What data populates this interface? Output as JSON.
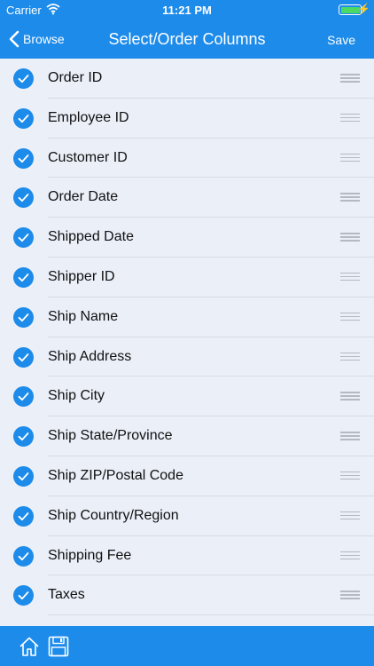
{
  "status_bar": {
    "carrier": "Carrier",
    "time": "11:21 PM"
  },
  "nav": {
    "back_label": "Browse",
    "title": "Select/Order Columns",
    "save_label": "Save"
  },
  "columns": [
    {
      "label": "Order ID",
      "checked": true
    },
    {
      "label": "Employee ID",
      "checked": true
    },
    {
      "label": "Customer ID",
      "checked": true
    },
    {
      "label": "Order Date",
      "checked": true
    },
    {
      "label": "Shipped Date",
      "checked": true
    },
    {
      "label": "Shipper ID",
      "checked": true
    },
    {
      "label": "Ship Name",
      "checked": true
    },
    {
      "label": "Ship Address",
      "checked": true
    },
    {
      "label": "Ship City",
      "checked": true
    },
    {
      "label": "Ship State/Province",
      "checked": true
    },
    {
      "label": "Ship ZIP/Postal Code",
      "checked": true
    },
    {
      "label": "Ship Country/Region",
      "checked": true
    },
    {
      "label": "Shipping Fee",
      "checked": true
    },
    {
      "label": "Taxes",
      "checked": true
    }
  ],
  "footer": {
    "icons": [
      "home-icon",
      "save-disk-icon"
    ]
  },
  "colors": {
    "accent": "#1d8bea",
    "background": "#eaeff8",
    "battery": "#4cd964"
  }
}
